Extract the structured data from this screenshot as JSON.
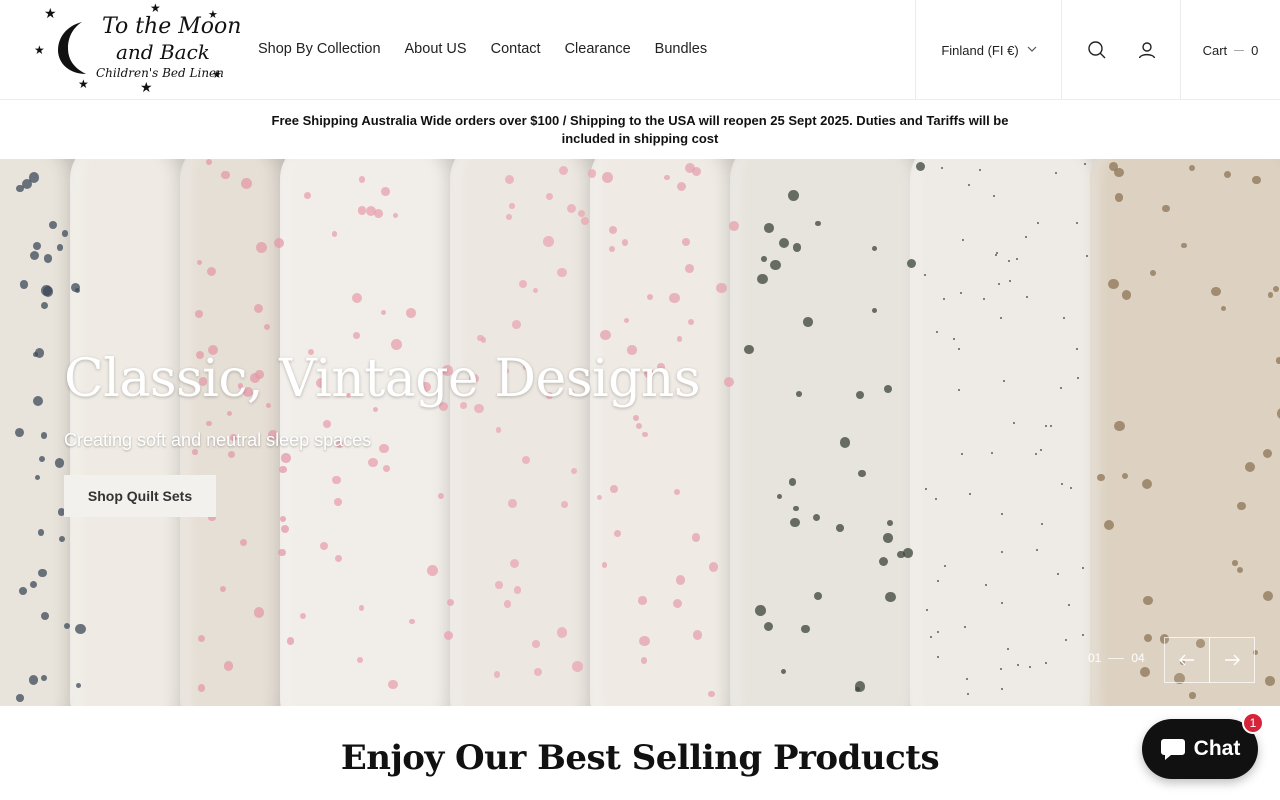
{
  "header": {
    "logo": {
      "line1": "To the Moon",
      "line2": "and Back",
      "line3": "Children's Bed Linen"
    },
    "nav": [
      {
        "label": "Shop By Collection"
      },
      {
        "label": "About US"
      },
      {
        "label": "Contact"
      },
      {
        "label": "Clearance"
      },
      {
        "label": "Bundles"
      }
    ],
    "country_selector": "Finland (FI €)",
    "icons": [
      "search-icon",
      "account-icon"
    ],
    "cart": {
      "label": "Cart",
      "count": "0"
    }
  },
  "announcement": "Free Shipping Australia Wide orders over $100 / Shipping to the USA will reopen 25 Sept 2025. Duties and Tariffs will be included in shipping cost",
  "hero": {
    "title": "Classic, Vintage Designs",
    "subtitle": "Creating soft and neutral sleep spaces",
    "button": "Shop Quilt Sets",
    "slide_current": "01",
    "slide_total": "04"
  },
  "section": {
    "title": "Enjoy Our Best Selling Products"
  },
  "chat": {
    "label": "Chat",
    "badge": "1"
  },
  "colors": {
    "accent": "#111111",
    "badge": "#d6243a",
    "hero_button_bg": "#f3f1ee"
  }
}
